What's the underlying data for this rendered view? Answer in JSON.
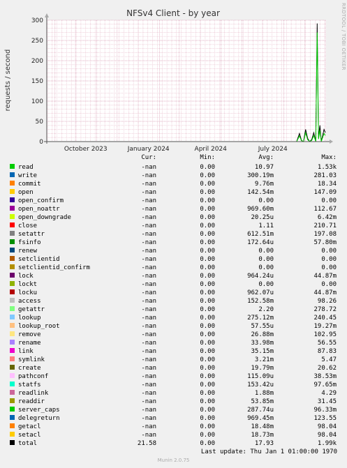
{
  "chart_data": {
    "type": "line",
    "title": "NFSv4 Client - by year",
    "ylabel": "requests / second",
    "xlabel": "",
    "x_ticks": [
      "October 2023",
      "January 2024",
      "April 2024",
      "July 2024"
    ],
    "y_ticks": [
      0,
      50,
      100,
      150,
      200,
      250,
      300
    ],
    "ylim": [
      0,
      300
    ],
    "grid": true,
    "series": [
      {
        "name": "total",
        "color": "#000000",
        "x": [
          "2024-08-20",
          "2024-08-24",
          "2024-08-27",
          "2024-08-30",
          "2024-09-02",
          "2024-09-05",
          "2024-09-08",
          "2024-09-11",
          "2024-09-14",
          "2024-09-17",
          "2024-09-19",
          "2024-09-21",
          "2024-09-23",
          "2024-09-25",
          "2024-09-27",
          "2024-09-29",
          "2024-10-01"
        ],
        "values": [
          0,
          20,
          3,
          0,
          30,
          8,
          0,
          5,
          22,
          0,
          292,
          10,
          40,
          0,
          15,
          30,
          22
        ]
      },
      {
        "name": "read",
        "color": "#00cc00",
        "x": [
          "2024-08-20",
          "2024-08-24",
          "2024-08-27",
          "2024-08-30",
          "2024-09-02",
          "2024-09-05",
          "2024-09-08",
          "2024-09-11",
          "2024-09-14",
          "2024-09-17",
          "2024-09-19",
          "2024-09-21",
          "2024-09-23",
          "2024-09-25",
          "2024-09-27",
          "2024-09-29",
          "2024-10-01"
        ],
        "values": [
          0,
          14,
          2,
          0,
          22,
          5,
          0,
          3,
          15,
          0,
          270,
          6,
          28,
          0,
          10,
          20,
          15
        ]
      }
    ]
  },
  "header": {
    "cur": "Cur:",
    "min": "Min:",
    "avg": "Avg:",
    "max": "Max:"
  },
  "legend": [
    {
      "name": "read",
      "color": "#00cc00",
      "cur": "-nan",
      "min": "0.00",
      "avg": "10.97",
      "max": "1.53k"
    },
    {
      "name": "write",
      "color": "#0066b3",
      "cur": "-nan",
      "min": "0.00",
      "avg": "300.19m",
      "max": "281.03"
    },
    {
      "name": "commit",
      "color": "#ff8000",
      "cur": "-nan",
      "min": "0.00",
      "avg": "9.76m",
      "max": "18.34"
    },
    {
      "name": "open",
      "color": "#ffcc00",
      "cur": "-nan",
      "min": "0.00",
      "avg": "142.54m",
      "max": "147.09"
    },
    {
      "name": "open_confirm",
      "color": "#330099",
      "cur": "-nan",
      "min": "0.00",
      "avg": "0.00",
      "max": "0.00"
    },
    {
      "name": "open_noattr",
      "color": "#990099",
      "cur": "-nan",
      "min": "0.00",
      "avg": "969.60m",
      "max": "112.67"
    },
    {
      "name": "open_downgrade",
      "color": "#ccff00",
      "cur": "-nan",
      "min": "0.00",
      "avg": "20.25u",
      "max": "6.42m"
    },
    {
      "name": "close",
      "color": "#ff0000",
      "cur": "-nan",
      "min": "0.00",
      "avg": "1.11",
      "max": "210.71"
    },
    {
      "name": "setattr",
      "color": "#808080",
      "cur": "-nan",
      "min": "0.00",
      "avg": "612.51m",
      "max": "197.08"
    },
    {
      "name": "fsinfo",
      "color": "#008f00",
      "cur": "-nan",
      "min": "0.00",
      "avg": "172.64u",
      "max": "57.80m"
    },
    {
      "name": "renew",
      "color": "#00487d",
      "cur": "-nan",
      "min": "0.00",
      "avg": "0.00",
      "max": "0.00"
    },
    {
      "name": "setclientid",
      "color": "#b35a00",
      "cur": "-nan",
      "min": "0.00",
      "avg": "0.00",
      "max": "0.00"
    },
    {
      "name": "setclientid_confirm",
      "color": "#b38f00",
      "cur": "-nan",
      "min": "0.00",
      "avg": "0.00",
      "max": "0.00"
    },
    {
      "name": "lock",
      "color": "#6b006b",
      "cur": "-nan",
      "min": "0.00",
      "avg": "964.24u",
      "max": "44.87m"
    },
    {
      "name": "lockt",
      "color": "#8fb300",
      "cur": "-nan",
      "min": "0.00",
      "avg": "0.00",
      "max": "0.00"
    },
    {
      "name": "locku",
      "color": "#b30000",
      "cur": "-nan",
      "min": "0.00",
      "avg": "962.07u",
      "max": "44.87m"
    },
    {
      "name": "access",
      "color": "#bebebe",
      "cur": "-nan",
      "min": "0.00",
      "avg": "152.58m",
      "max": "98.26"
    },
    {
      "name": "getattr",
      "color": "#80ff80",
      "cur": "-nan",
      "min": "0.00",
      "avg": "2.20",
      "max": "278.72"
    },
    {
      "name": "lookup",
      "color": "#80c9ff",
      "cur": "-nan",
      "min": "0.00",
      "avg": "275.12m",
      "max": "240.45"
    },
    {
      "name": "lookup_root",
      "color": "#ffc080",
      "cur": "-nan",
      "min": "0.00",
      "avg": "57.55u",
      "max": "19.27m"
    },
    {
      "name": "remove",
      "color": "#ffe680",
      "cur": "-nan",
      "min": "0.00",
      "avg": "26.88m",
      "max": "102.95"
    },
    {
      "name": "rename",
      "color": "#aa80ff",
      "cur": "-nan",
      "min": "0.00",
      "avg": "33.98m",
      "max": "56.55"
    },
    {
      "name": "link",
      "color": "#ee00cc",
      "cur": "-nan",
      "min": "0.00",
      "avg": "35.15m",
      "max": "87.83"
    },
    {
      "name": "symlink",
      "color": "#ff8080",
      "cur": "-nan",
      "min": "0.00",
      "avg": "3.21m",
      "max": "5.47"
    },
    {
      "name": "create",
      "color": "#666600",
      "cur": "-nan",
      "min": "0.00",
      "avg": "19.79m",
      "max": "20.62"
    },
    {
      "name": "pathconf",
      "color": "#ffbfff",
      "cur": "-nan",
      "min": "0.00",
      "avg": "115.09u",
      "max": "38.53m"
    },
    {
      "name": "statfs",
      "color": "#00ffcc",
      "cur": "-nan",
      "min": "0.00",
      "avg": "153.42u",
      "max": "97.65m"
    },
    {
      "name": "readlink",
      "color": "#cc6699",
      "cur": "-nan",
      "min": "0.00",
      "avg": "1.88m",
      "max": "4.29"
    },
    {
      "name": "readdir",
      "color": "#999900",
      "cur": "-nan",
      "min": "0.00",
      "avg": "53.85m",
      "max": "31.45"
    },
    {
      "name": "server_caps",
      "color": "#00cc00",
      "cur": "-nan",
      "min": "0.00",
      "avg": "287.74u",
      "max": "96.33m"
    },
    {
      "name": "delegreturn",
      "color": "#0066b3",
      "cur": "-nan",
      "min": "0.00",
      "avg": "969.45m",
      "max": "123.55"
    },
    {
      "name": "getacl",
      "color": "#ff8000",
      "cur": "-nan",
      "min": "0.00",
      "avg": "18.48m",
      "max": "98.04"
    },
    {
      "name": "setacl",
      "color": "#ffcc00",
      "cur": "-nan",
      "min": "0.00",
      "avg": "18.73m",
      "max": "98.04"
    },
    {
      "name": "total",
      "color": "#000000",
      "cur": "21.58",
      "min": "0.00",
      "avg": "17.93",
      "max": "1.99k"
    }
  ],
  "footer": {
    "last_update": "Last update: Thu Jan  1 01:00:00 1970",
    "munin": "Munin 2.0.75",
    "watermark": "RRDTOOL / TOBI OETIKER"
  }
}
